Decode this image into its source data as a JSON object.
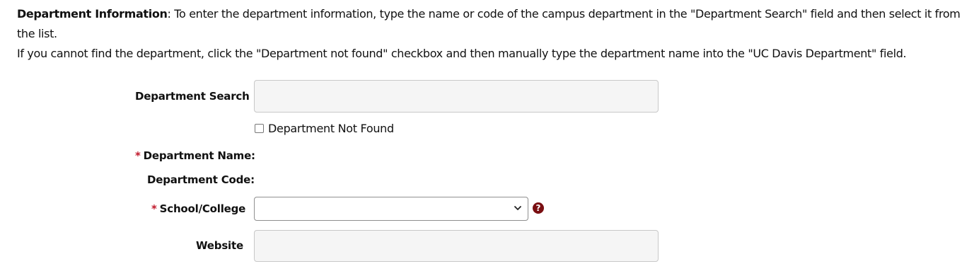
{
  "intro": {
    "lead": "Department Information",
    "line1_rest": ": To enter the department information, type the name or code of the campus department in the \"Department Search\" field and then select it from the list.",
    "line2": "If you cannot find the department, click the \"Department not found\" checkbox and then manually type the department name into the \"UC Davis Department\" field."
  },
  "form": {
    "required_marker": "*",
    "department_search_label": "Department Search",
    "department_search_value": "",
    "not_found_label": "Department Not Found",
    "not_found_checked": false,
    "department_name_label": "Department Name:",
    "department_code_label": "Department Code:",
    "school_college_label": "School/College",
    "school_college_value": "",
    "website_label": "Website",
    "website_value": ""
  },
  "colors": {
    "required": "#c0182a",
    "help_icon": "#7a0f12",
    "input_background": "#f5f5f5"
  },
  "icons": {
    "help": "question-circle-icon",
    "select_arrow": "chevron-down-icon"
  }
}
